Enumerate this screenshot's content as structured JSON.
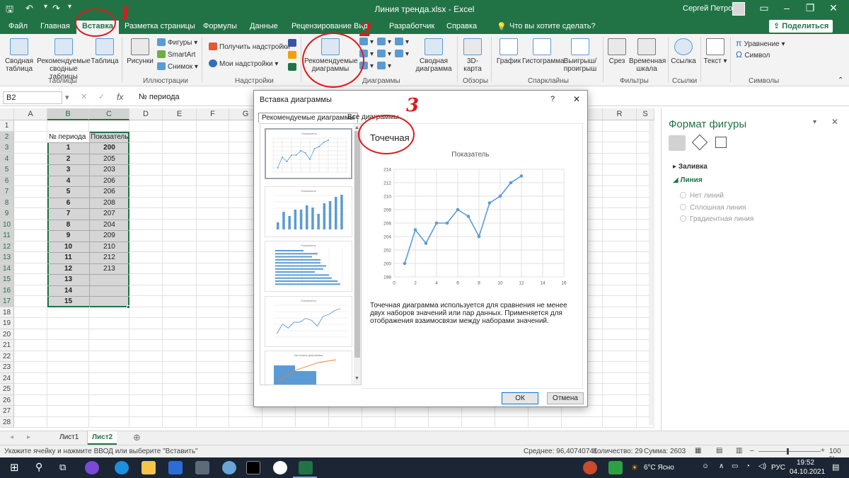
{
  "window": {
    "title": "Линия тренда.xlsx  -  Excel",
    "user": "Сергей Петров"
  },
  "tabs": [
    "Файл",
    "Главная",
    "Вставка",
    "Разметка страницы",
    "Формулы",
    "Данные",
    "Рецензирование",
    "Вид",
    "Разработчик",
    "Справка"
  ],
  "active_tab": "Вставка",
  "tell_me": "Что вы хотите сделать?",
  "share": "Поделиться",
  "ribbon": {
    "svod": "Сводная\nтаблица",
    "rec_svod": "Рекомендуемые\nсводные таблицы",
    "table": "Таблица",
    "pictures": "Рисунки",
    "shapes": "Фигуры",
    "smartart": "SmartArt",
    "snapshot": "Снимок",
    "get_addins": "Получить надстройки",
    "my_addins": "Мои надстройки",
    "rec_charts": "Рекомендуемые\nдиаграммы",
    "pivot_chart": "Сводная\nдиаграмма",
    "map3d": "3D-\nкарта",
    "sp_graph": "График",
    "sp_hist": "Гистограмма",
    "sp_winloss": "Выигрыш/\nпроигрыш",
    "slicer": "Срез",
    "timeline": "Временная\nшкала",
    "link": "Ссылка",
    "text": "Текст",
    "equation": "Уравнение",
    "symbol": "Символ",
    "groups": {
      "tables": "Таблицы",
      "illustrations": "Иллюстрации",
      "addins": "Надстройки",
      "charts": "Диаграммы",
      "tours": "Обзоры",
      "sparklines": "Спарклайны",
      "filters": "Фильтры",
      "links": "Ссылки",
      "symbols": "Символы"
    }
  },
  "formula": {
    "cell": "B2",
    "value": "№ периода"
  },
  "columns": [
    "A",
    "B",
    "C",
    "D",
    "E",
    "F",
    "G",
    "H",
    "I",
    "J",
    "K",
    "L",
    "M",
    "N",
    "O",
    "P",
    "Q",
    "R",
    "S"
  ],
  "rows": [
    "1",
    "2",
    "3",
    "4",
    "5",
    "6",
    "7",
    "8",
    "9",
    "10",
    "11",
    "12",
    "13",
    "14",
    "15",
    "16",
    "17",
    "18",
    "19",
    "20",
    "21",
    "22",
    "23",
    "24",
    "25",
    "26",
    "27",
    "28"
  ],
  "table": {
    "headers": [
      "№ периода",
      "Показатель"
    ],
    "periods": [
      "1",
      "2",
      "3",
      "4",
      "5",
      "6",
      "7",
      "8",
      "9",
      "10",
      "11",
      "12",
      "13",
      "14",
      "15"
    ],
    "values": [
      "200",
      "205",
      "203",
      "206",
      "206",
      "208",
      "207",
      "204",
      "209",
      "210",
      "212",
      "213",
      "",
      "",
      ""
    ]
  },
  "dialog": {
    "title": "Вставка диаграммы",
    "help": "?",
    "close": "✕",
    "tab_recommended": "Рекомендуемые диаграммы",
    "tab_all": "Все диаграммы",
    "chart_type": "Точечная",
    "description": "Точечная диаграмма используется для сравнения не менее двух наборов значений или пар данных. Применяется для отображения взаимосвязи между наборами значений.",
    "ok": "ОК",
    "cancel": "Отмена",
    "thumb_titles": [
      "Показатель",
      "Показатель",
      "Показатель",
      "Показатель",
      "Заголовок диаграммы"
    ]
  },
  "chart_data": {
    "type": "scatter",
    "title": "Показатель",
    "x": [
      1,
      2,
      3,
      4,
      5,
      6,
      7,
      8,
      9,
      10,
      11,
      12
    ],
    "y": [
      200,
      205,
      203,
      206,
      206,
      208,
      207,
      204,
      209,
      210,
      212,
      213
    ],
    "xlim": [
      0,
      16
    ],
    "ylim": [
      198,
      214
    ],
    "xticks": [
      "0",
      "2",
      "4",
      "6",
      "8",
      "10",
      "12",
      "14",
      "16"
    ],
    "yticks": [
      "198",
      "200",
      "202",
      "204",
      "206",
      "208",
      "210",
      "212",
      "214"
    ],
    "grid": true,
    "color": "#5b9bd5"
  },
  "format_pane": {
    "title": "Формат фигуры",
    "fill": "Заливка",
    "line": "Линия",
    "opt1": "Нет линий",
    "opt2": "Сплошная линия",
    "opt3": "Градиентная линия"
  },
  "sheets": [
    "Лист1",
    "Лист2"
  ],
  "active_sheet": "Лист2",
  "status": {
    "hint": "Укажите ячейку и нажмите ВВОД или выберите \"Вставить\"",
    "avg": "Среднее: 96,40740741",
    "count": "Количество: 29",
    "sum": "Сумма: 2603",
    "zoom": "100 %"
  },
  "taskbar": {
    "weather": "6°C  Ясно",
    "lang": "РУС",
    "time": "19:52",
    "date": "04.10.2021"
  },
  "annotations": [
    "1",
    "2",
    "3"
  ]
}
